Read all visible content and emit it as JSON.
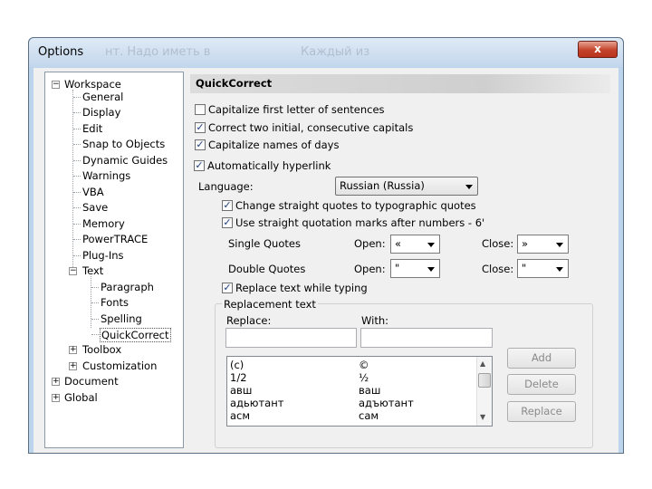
{
  "window": {
    "title": "Options",
    "close_glyph": "x",
    "ghost_text_1": "нт. Надо иметь в",
    "ghost_text_2": "Каждый из"
  },
  "tree": {
    "workspace": "Workspace",
    "workspace_children": [
      "General",
      "Display",
      "Edit",
      "Snap to Objects",
      "Dynamic Guides",
      "Warnings",
      "VBA",
      "Save",
      "Memory",
      "PowerTRACE",
      "Plug-Ins"
    ],
    "text": "Text",
    "text_children": [
      "Paragraph",
      "Fonts",
      "Spelling",
      "QuickCorrect"
    ],
    "toolbox": "Toolbox",
    "customization": "Customization",
    "document": "Document",
    "global": "Global",
    "expander_minus": "−",
    "expander_plus": "+"
  },
  "panel": {
    "header": "QuickCorrect",
    "capitalize_first": "Capitalize first letter of sentences",
    "correct_two_initial": "Correct two initial, consecutive capitals",
    "capitalize_days": "Capitalize names of days",
    "auto_hyperlink": "Automatically hyperlink",
    "language_label": "Language:",
    "language_value": "Russian (Russia)",
    "change_quotes": "Change straight quotes to typographic quotes",
    "straight_after_numbers": "Use straight quotation marks after numbers - 6'",
    "single_quotes": "Single Quotes",
    "double_quotes": "Double Quotes",
    "open": "Open:",
    "close": "Close:",
    "single_open": "«",
    "single_close": "»",
    "double_open": "\"",
    "double_close": "\"",
    "replace_while_typing": "Replace text while typing",
    "replacement_text": "Replacement text",
    "replace_label": "Replace:",
    "with_label": "With:",
    "list": [
      {
        "replace": "(c)",
        "with": "©"
      },
      {
        "replace": "1/2",
        "with": "½"
      },
      {
        "replace": "авш",
        "with": "ваш"
      },
      {
        "replace": "адьютант",
        "with": "адъютант"
      },
      {
        "replace": "асм",
        "with": "сам"
      }
    ],
    "add": "Add",
    "delete": "Delete",
    "replace_btn": "Replace",
    "check_mark": "✓",
    "scroll_up": "▲",
    "scroll_down": "▼"
  },
  "checks": {
    "capitalize_first": false,
    "correct_two_initial": true,
    "capitalize_days": true,
    "auto_hyperlink": true,
    "change_quotes": true,
    "straight_after_numbers": true,
    "replace_while_typing": true
  }
}
